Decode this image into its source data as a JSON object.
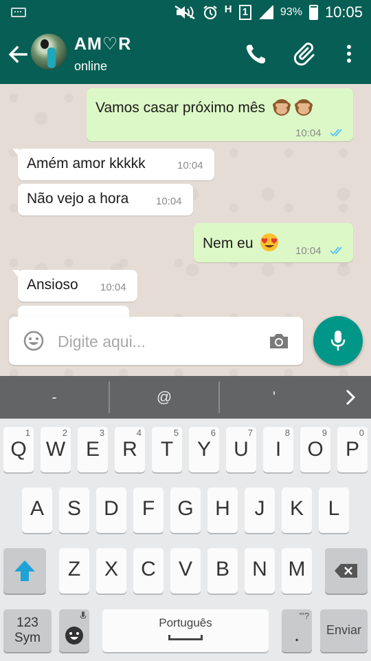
{
  "status_bar": {
    "network_type": "H",
    "sim_slot": "1",
    "battery": "93%",
    "time": "10:05",
    "icons": [
      "keyboard-indicator-icon",
      "mute-icon",
      "alarm-icon",
      "data-arrows-icon",
      "sim-icon",
      "signal-icon",
      "battery-icon"
    ]
  },
  "toolbar": {
    "contact_name": "AM♡R",
    "contact_status": "online",
    "colors": {
      "bar": "#075e54",
      "accent": "#009688"
    }
  },
  "messages": [
    {
      "direction": "out",
      "text": "Vamos casar próximo mês",
      "emoji": [
        "see-no-evil-monkey-emoji",
        "see-no-evil-monkey-emoji"
      ],
      "time": "10:04",
      "status": "read-double-tick-icon"
    },
    {
      "direction": "in",
      "text": "Amém amor kkkkk",
      "time": "10:04"
    },
    {
      "direction": "in",
      "text": "Não vejo a hora",
      "time": "10:04"
    },
    {
      "direction": "out",
      "text": "Nem eu",
      "emoji": [
        "heart-eyes-emoji"
      ],
      "time": "10:04",
      "status": "read-double-tick-icon"
    },
    {
      "direction": "in",
      "text": "Ansioso",
      "time": "10:04"
    }
  ],
  "composer": {
    "placeholder": "Digite aqui..."
  },
  "suggestions": [
    "-",
    "@",
    "'"
  ],
  "keyboard": {
    "row1": [
      {
        "key": "Q",
        "hint": "1"
      },
      {
        "key": "W",
        "hint": "2"
      },
      {
        "key": "E",
        "hint": "3"
      },
      {
        "key": "R",
        "hint": "4"
      },
      {
        "key": "T",
        "hint": "5"
      },
      {
        "key": "Y",
        "hint": "6"
      },
      {
        "key": "U",
        "hint": "7"
      },
      {
        "key": "I",
        "hint": "8"
      },
      {
        "key": "O",
        "hint": "9"
      },
      {
        "key": "P",
        "hint": "0"
      }
    ],
    "row2": [
      "A",
      "S",
      "D",
      "F",
      "G",
      "H",
      "J",
      "K",
      "L"
    ],
    "row3": [
      "Z",
      "X",
      "C",
      "V",
      "B",
      "N",
      "M"
    ],
    "symbols_key": "123\nSym",
    "symbols_line1": "123",
    "symbols_line2": "Sym",
    "space_label": "Português",
    "period_key": ".",
    "period_hint": "'\"?",
    "enter_label": "Enviar"
  }
}
